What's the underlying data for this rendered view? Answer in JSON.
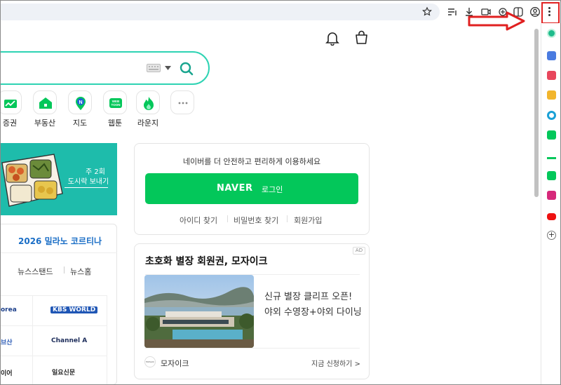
{
  "page": {
    "search": {
      "placeholder": ""
    },
    "shortcuts": [
      {
        "label": "증권",
        "icon": "stock-chart-icon"
      },
      {
        "label": "부동산",
        "icon": "house-icon"
      },
      {
        "label": "지도",
        "icon": "map-pin-icon"
      },
      {
        "label": "웹툰",
        "icon": "webtoon-icon"
      },
      {
        "label": "라운지",
        "icon": "flame-icon"
      },
      {
        "label": "",
        "icon": "more-icon"
      }
    ],
    "webtoon_icon_text": "WEB TOON",
    "promo": {
      "line1": "주 2회",
      "line2": "도시락 보내기"
    },
    "news": {
      "title": "2026 밀라노 코르티나",
      "tabs": [
        "뉴스스탠드",
        "뉴스홈"
      ],
      "press": [
        "orea",
        "KBS WORLD",
        "브산",
        "Channel A",
        "이어",
        "일요신문"
      ]
    },
    "login": {
      "message": "네이버를 더 안전하고 편리하게 이용하세요",
      "brand": "NAVER",
      "button_label": "로그인",
      "links": [
        "아이디 찾기",
        "비밀번호 찾기",
        "회원가입"
      ]
    },
    "ad": {
      "badge": "AD",
      "title": "초호화 별장 회원권, 모자이크",
      "description": "신규 별장 클리프 오픈! 야외 수영장+야외 다이닝",
      "brand": "모자이크",
      "logo_text": "MOSAIC",
      "cta": "지금 신청하기 >"
    }
  },
  "colors": {
    "naver_green": "#03c75a",
    "search_border": "#2ed3b3",
    "promo_teal": "#1ebcab",
    "highlight_red": "#e02020",
    "news_blue": "#1a6ec6"
  },
  "side_panel_icons": [
    "green-circle-icon",
    "blue-app-icon",
    "red-heart-icon",
    "yellow-star-icon",
    "blue-c-icon",
    "green-bag-icon",
    "green-stock-icon",
    "green-webtoon-icon",
    "instagram-icon",
    "youtube-icon",
    "add-icon"
  ]
}
